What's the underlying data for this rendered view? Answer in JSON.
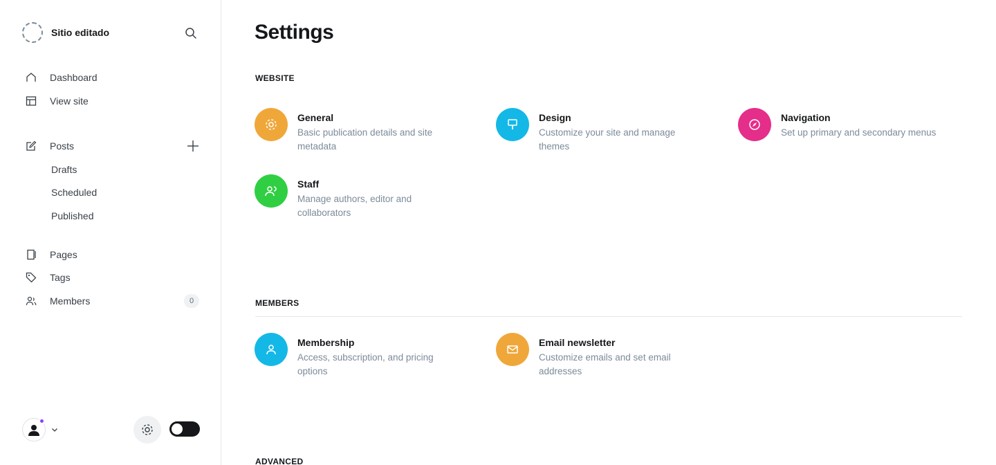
{
  "brand": {
    "name": "Sitio editado"
  },
  "nav": {
    "dashboard": "Dashboard",
    "view_site": "View site",
    "posts": "Posts",
    "drafts": "Drafts",
    "scheduled": "Scheduled",
    "published": "Published",
    "pages": "Pages",
    "tags": "Tags",
    "members": "Members",
    "members_count": "0"
  },
  "main": {
    "title": "Settings",
    "sections": {
      "website": "WEBSITE",
      "members": "MEMBERS",
      "advanced": "ADVANCED"
    },
    "website_items": [
      {
        "title": "General",
        "desc": "Basic publication details and site metadata",
        "color": "#f0a73a",
        "icon": "gear-icon"
      },
      {
        "title": "Design",
        "desc": "Customize your site and manage themes",
        "color": "#14b8e6",
        "icon": "paintbrush-icon"
      },
      {
        "title": "Navigation",
        "desc": "Set up primary and secondary menus",
        "color": "#e52d8a",
        "icon": "compass-icon"
      },
      {
        "title": "Staff",
        "desc": "Manage authors, editor and collaborators",
        "color": "#30cf43",
        "icon": "users-icon"
      }
    ],
    "members_items": [
      {
        "title": "Membership",
        "desc": "Access, subscription, and pricing options",
        "color": "#14b8e6",
        "icon": "members-icon"
      },
      {
        "title": "Email newsletter",
        "desc": "Customize emails and set email addresses",
        "color": "#f0a73a",
        "icon": "email-icon"
      }
    ]
  },
  "colors": {
    "accent": "#8e42ff",
    "text": "#15171a",
    "muted": "#7c8b9a"
  }
}
